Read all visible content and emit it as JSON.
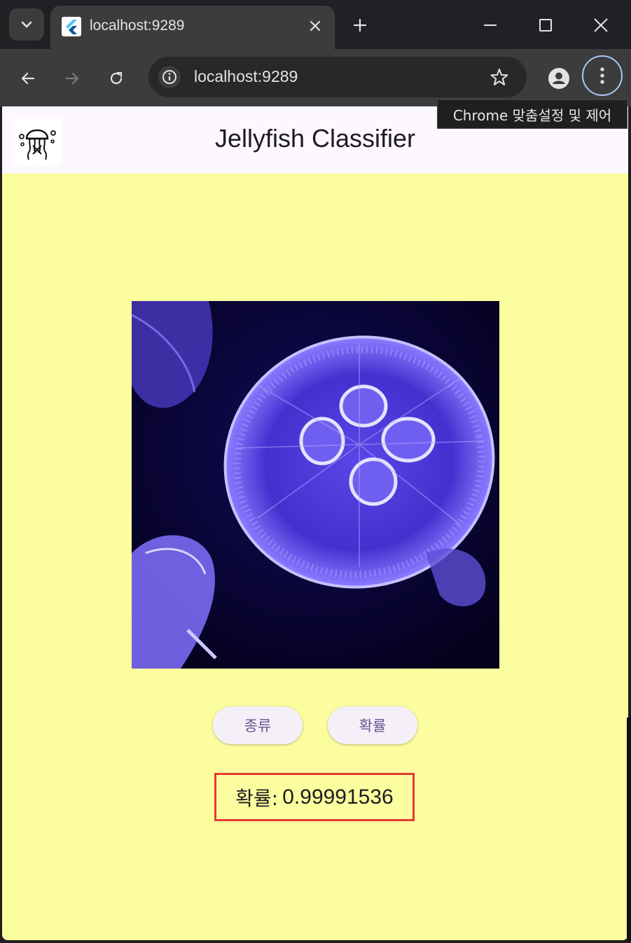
{
  "browser": {
    "tab_title": "localhost:9289",
    "url": "localhost:9289",
    "tooltip": "Chrome 맞춤설정 및 제어"
  },
  "app": {
    "title": "Jellyfish Classifier",
    "buttons": {
      "species": "종류",
      "probability": "확률"
    },
    "result": {
      "label": "확률:",
      "value": "0.99991536"
    }
  },
  "colors": {
    "page_background": "#fbfd9e",
    "appbar_background": "#fdf7ff",
    "result_border": "#e53935",
    "button_text": "#65558f"
  },
  "icons": {
    "logo": "jellyfish-icon",
    "favicon": "flutter-icon"
  }
}
